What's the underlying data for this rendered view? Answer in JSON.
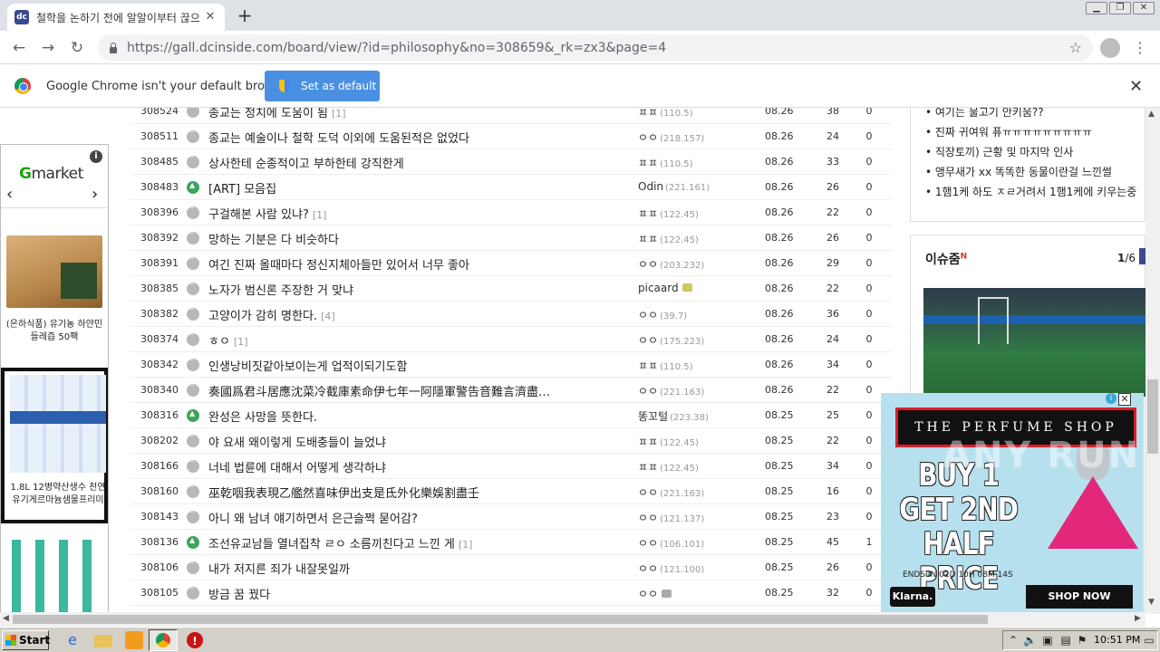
{
  "browser": {
    "tab_title": "철학을 논하기 전에 알알이부터 끊으",
    "tab_favicon": "dc",
    "url": "https://gall.dcinside.com/board/view/?id=philosophy&no=308659&_rk=zx3&page=4",
    "infobar_message": "Google Chrome isn't your default browser",
    "infobar_button": "Set as default"
  },
  "left_ad": {
    "brand_main": "G",
    "brand_rest": "market",
    "info_glyph": "i",
    "items": [
      {
        "caption": "(은하식품) 유기농 하얀민들레즙 50팩"
      },
      {
        "caption": "1.8L 12병약산생수 천연유기게르마늄샘물프리미"
      },
      {
        "caption": ""
      }
    ]
  },
  "posts": [
    {
      "num": "308524",
      "icon": "text",
      "subject": "종교는 정치에 도움이 됨",
      "reply": "[1]",
      "writer": "ㅍㅍ",
      "ip": "(110.5)",
      "gc": "",
      "date": "08.26",
      "views": "38",
      "reco": "0"
    },
    {
      "num": "308511",
      "icon": "text",
      "subject": "종교는 예술이나 철학 도덕 이외에 도움된적은 없었다",
      "reply": "",
      "writer": "ㅇㅇ",
      "ip": "(218.157)",
      "gc": "",
      "date": "08.26",
      "views": "24",
      "reco": "0"
    },
    {
      "num": "308485",
      "icon": "text",
      "subject": "상사한테 순종적이고 부하한테 강직한게",
      "reply": "",
      "writer": "ㅍㅍ",
      "ip": "(110.5)",
      "gc": "",
      "date": "08.26",
      "views": "33",
      "reco": "0"
    },
    {
      "num": "308483",
      "icon": "img",
      "subject": "[ART] 모음집",
      "reply": "",
      "writer": "Odin",
      "ip": "(221.161)",
      "gc": "",
      "date": "08.26",
      "views": "26",
      "reco": "0"
    },
    {
      "num": "308396",
      "icon": "text",
      "subject": "구걸해본 사람 있냐?",
      "reply": "[1]",
      "writer": "ㅍㅍ",
      "ip": "(122.45)",
      "gc": "",
      "date": "08.26",
      "views": "22",
      "reco": "0"
    },
    {
      "num": "308392",
      "icon": "text",
      "subject": "망하는 기분은 다 비슷하다",
      "reply": "",
      "writer": "ㅍㅍ",
      "ip": "(122.45)",
      "gc": "",
      "date": "08.26",
      "views": "26",
      "reco": "0"
    },
    {
      "num": "308391",
      "icon": "text",
      "subject": "여긴 진짜 올때마다 정신지체아들만 있어서 너무 좋아",
      "reply": "",
      "writer": "ㅇㅇ",
      "ip": "(203.232)",
      "gc": "",
      "date": "08.26",
      "views": "29",
      "reco": "0"
    },
    {
      "num": "308385",
      "icon": "text",
      "subject": "노자가 범신론 주장한 거 맞냐",
      "reply": "",
      "writer": "picaard",
      "ip": "",
      "gc": "half",
      "date": "08.26",
      "views": "22",
      "reco": "0"
    },
    {
      "num": "308382",
      "icon": "text",
      "subject": "고양이가 감히 명한다.",
      "reply": "[4]",
      "writer": "ㅇㅇ",
      "ip": "(39.7)",
      "gc": "",
      "date": "08.26",
      "views": "36",
      "reco": "0"
    },
    {
      "num": "308374",
      "icon": "text",
      "subject": "ㅎㅇ",
      "reply": "[1]",
      "writer": "ㅇㅇ",
      "ip": "(175.223)",
      "gc": "",
      "date": "08.26",
      "views": "24",
      "reco": "0"
    },
    {
      "num": "308342",
      "icon": "text",
      "subject": "인생낭비짓같아보이는게 업적이되기도함",
      "reply": "",
      "writer": "ㅍㅍ",
      "ip": "(110.5)",
      "gc": "",
      "date": "08.26",
      "views": "34",
      "reco": "0"
    },
    {
      "num": "308340",
      "icon": "text",
      "subject": "奏國爲君斗居應沈菜冷截庫素命伊七年一阿隱軍警告音難言濟盡…",
      "reply": "",
      "writer": "ㅇㅇ",
      "ip": "(221.163)",
      "gc": "",
      "date": "08.26",
      "views": "22",
      "reco": "0"
    },
    {
      "num": "308316",
      "icon": "img",
      "subject": "완성은 사망을 뜻한다.",
      "reply": "",
      "writer": "똥꼬털",
      "ip": "(223.38)",
      "gc": "",
      "date": "08.25",
      "views": "25",
      "reco": "0"
    },
    {
      "num": "308202",
      "icon": "text",
      "subject": "야 요새 왜이렇게 도배충들이 늘었냐",
      "reply": "",
      "writer": "ㅍㅍ",
      "ip": "(122.45)",
      "gc": "",
      "date": "08.25",
      "views": "22",
      "reco": "0"
    },
    {
      "num": "308166",
      "icon": "text",
      "subject": "너네 법륜에 대해서 어떻게 생각하냐",
      "reply": "",
      "writer": "ㅍㅍ",
      "ip": "(122.45)",
      "gc": "",
      "date": "08.25",
      "views": "34",
      "reco": "0"
    },
    {
      "num": "308160",
      "icon": "text",
      "subject": "巫乾咽我表現乙艦然喜味伊出支是氐外化樂娛割盡壬",
      "reply": "",
      "writer": "ㅇㅇ",
      "ip": "(221.163)",
      "gc": "",
      "date": "08.25",
      "views": "16",
      "reco": "0"
    },
    {
      "num": "308143",
      "icon": "text",
      "subject": "아니 왜 남녀 얘기하면서 은근슬쩍 묻어감?",
      "reply": "",
      "writer": "ㅇㅇ",
      "ip": "(121.137)",
      "gc": "",
      "date": "08.25",
      "views": "23",
      "reco": "0"
    },
    {
      "num": "308136",
      "icon": "img",
      "subject": "조선유교남들 열녀집착 ㄹㅇ 소름끼친다고 느낀 게",
      "reply": "[1]",
      "writer": "ㅇㅇ",
      "ip": "(106.101)",
      "gc": "",
      "date": "08.25",
      "views": "45",
      "reco": "1"
    },
    {
      "num": "308106",
      "icon": "text",
      "subject": "내가 저지른 죄가 내잘못일까",
      "reply": "",
      "writer": "ㅇㅇ",
      "ip": "(121.100)",
      "gc": "",
      "date": "08.25",
      "views": "26",
      "reco": "0"
    },
    {
      "num": "308105",
      "icon": "text",
      "subject": "방금 꿈 꿨다",
      "reply": "",
      "writer": "ㅇㅇ",
      "ip": "",
      "gc": "fixed",
      "date": "08.25",
      "views": "32",
      "reco": "0"
    }
  ],
  "right_list": [
    "• 여기는 물고기 안키움??",
    "• 진짜 귀여워 퓨ㅠㅠㅠㅠㅠㅠㅠㅠㅠ",
    "• 직장토끼) 근황 및 마지막 인사",
    "• 앵무새가 xx 똑똑한 동물이란걸 느낀썰",
    "• 1햄1케 하도 ㅈㄹ거려서 1햄1케에 키우는중"
  ],
  "issue": {
    "title": "이슈줌",
    "badge": "N",
    "page_current": "1",
    "page_total": "/6"
  },
  "perfume_ad": {
    "banner": "THE PERFUME SHOP",
    "headline": "BUY 1 GET 2ND HALF PRICE",
    "ends": "ENDS IN 02D 10H 08M 14S",
    "klarna": "Klarna.",
    "cta": "SHOP NOW",
    "close": "✕",
    "info": "i"
  },
  "watermark": "ANY RUN",
  "taskbar": {
    "start": "Start",
    "time": "10:51 PM"
  }
}
